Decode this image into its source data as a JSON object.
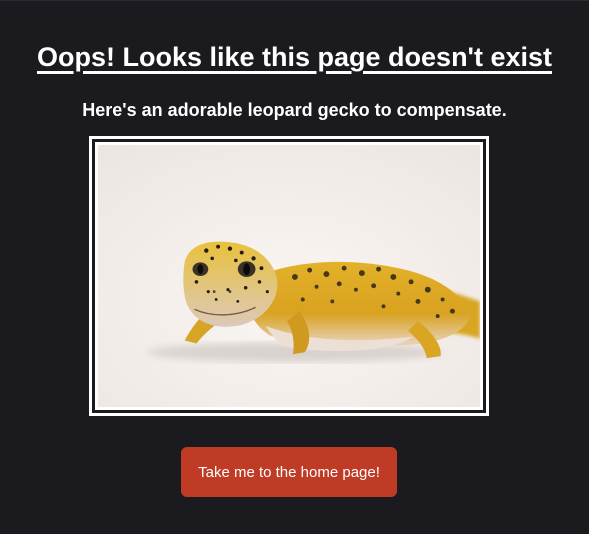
{
  "error": {
    "heading": "Oops! Looks like this page doesn't exist",
    "subheading": "Here's an adorable leopard gecko to compensate."
  },
  "image": {
    "subject": "leopard gecko"
  },
  "actions": {
    "home_button_label": "Take me to the home page!"
  },
  "colors": {
    "background": "#1b1a1f",
    "text": "#ffffff",
    "button": "#bf3b25",
    "frame": "#ffffff"
  }
}
